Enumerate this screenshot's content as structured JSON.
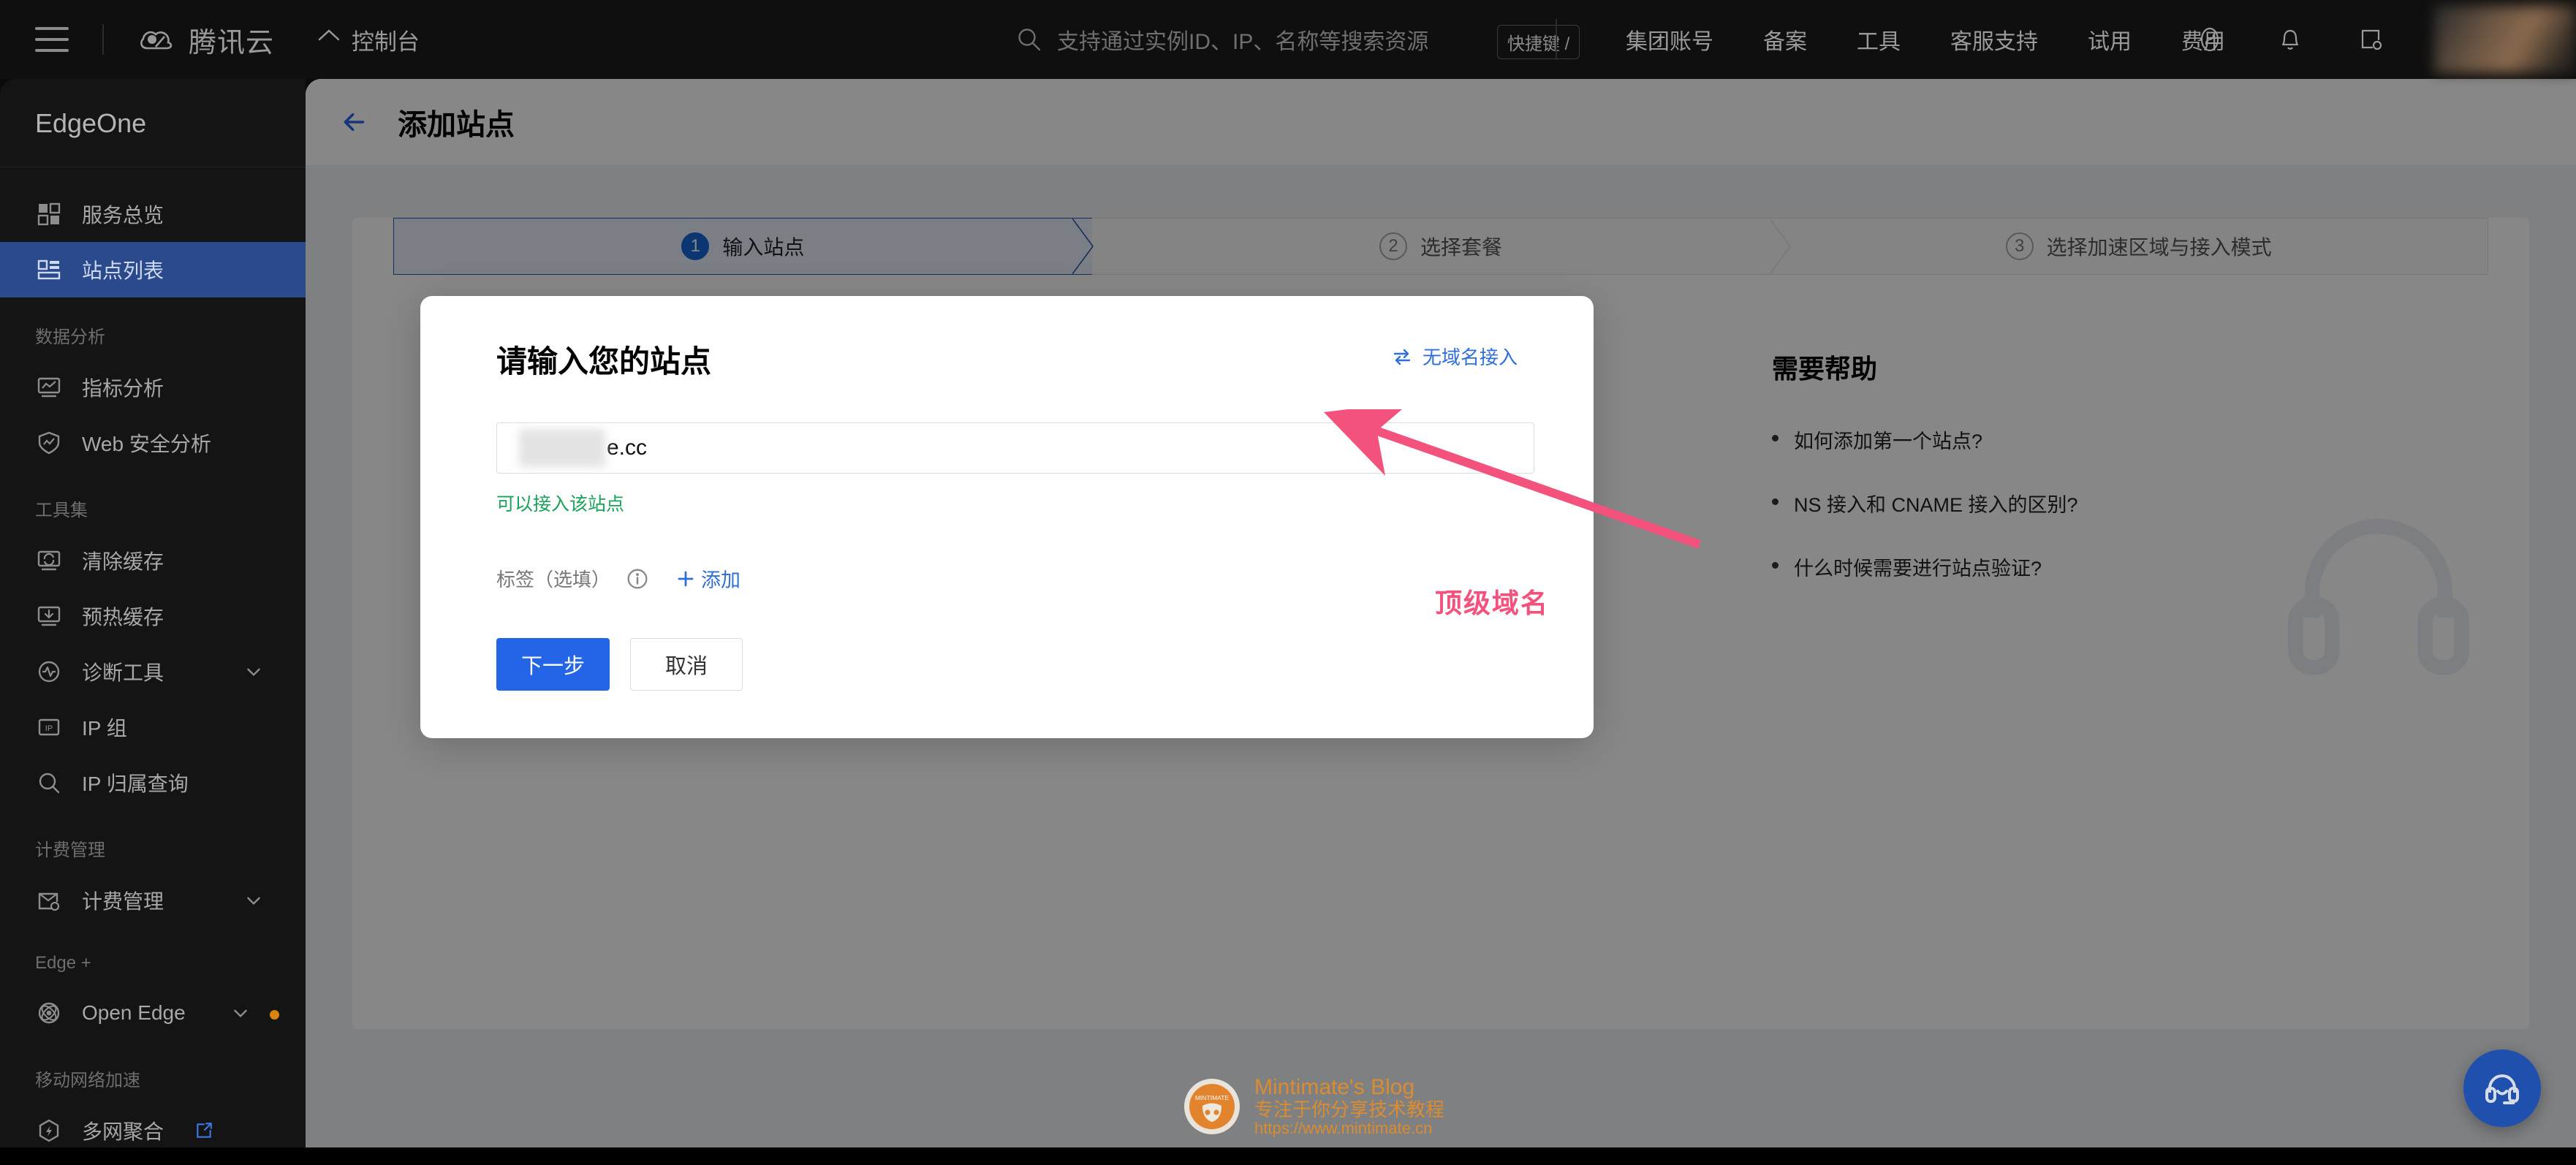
{
  "topbar": {
    "menu_icon": "hamburger-icon",
    "brand": "腾讯云",
    "console": "控制台",
    "search_placeholder": "支持通过实例ID、IP、名称等搜索资源",
    "shortcut_hint": "快捷键 /",
    "nav": [
      {
        "label": "集团账号"
      },
      {
        "label": "备案"
      },
      {
        "label": "工具"
      },
      {
        "label": "客服支持"
      },
      {
        "label": "试用"
      },
      {
        "label": "费用"
      }
    ],
    "icons": [
      "wave-icon",
      "bell-icon",
      "workorder-icon"
    ]
  },
  "sidebar": {
    "title": "EdgeOne",
    "groups": [
      {
        "label": "",
        "items": [
          {
            "label": "服务总览",
            "icon": "grid-icon",
            "active": false
          },
          {
            "label": "站点列表",
            "icon": "sites-icon",
            "active": true
          }
        ]
      },
      {
        "label": "数据分析",
        "items": [
          {
            "label": "指标分析",
            "icon": "chart-monitor-icon",
            "active": false
          },
          {
            "label": "Web 安全分析",
            "icon": "shield-icon",
            "active": false
          }
        ]
      },
      {
        "label": "工具集",
        "items": [
          {
            "label": "清除缓存",
            "icon": "refresh-monitor-icon",
            "active": false
          },
          {
            "label": "预热缓存",
            "icon": "download-monitor-icon",
            "active": false
          },
          {
            "label": "诊断工具",
            "icon": "pulse-icon",
            "active": false,
            "chevron": true
          },
          {
            "label": "IP 组",
            "icon": "ip-box-icon",
            "active": false
          },
          {
            "label": "IP 归属查询",
            "icon": "search-icon",
            "active": false
          }
        ]
      },
      {
        "label": "计费管理",
        "items": [
          {
            "label": "计费管理",
            "icon": "billing-icon",
            "active": false,
            "chevron": true
          }
        ]
      },
      {
        "label": "Edge +",
        "items": [
          {
            "label": "Open Edge",
            "icon": "atom-icon",
            "active": false,
            "chevron": true,
            "dot": true
          }
        ]
      },
      {
        "label": "移动网络加速",
        "items": [
          {
            "label": "多网聚合",
            "icon": "hex-bolt-icon",
            "active": false,
            "external": true
          }
        ]
      }
    ]
  },
  "page": {
    "back_icon": "arrow-left-icon",
    "title": "添加站点"
  },
  "stepper": {
    "steps": [
      {
        "num": "1",
        "label": "输入站点",
        "active": true
      },
      {
        "num": "2",
        "label": "选择套餐",
        "active": false
      },
      {
        "num": "3",
        "label": "选择加速区域与接入模式",
        "active": false
      }
    ]
  },
  "dialog": {
    "title": "请输入您的站点",
    "nodomain_link": "无域名接入",
    "nodomain_icon": "swap-icon",
    "input_value": "e.cc",
    "input_masked": true,
    "valid_message": "可以接入该站点",
    "tag_label": "标签（选填）",
    "tag_info_icon": "info-icon",
    "add_tag_label": "添加",
    "add_tag_icon": "plus-icon",
    "primary_button": "下一步",
    "cancel_button": "取消"
  },
  "help": {
    "title": "需要帮助",
    "items": [
      {
        "label": "如何添加第一个站点?"
      },
      {
        "label": "NS 接入和 CNAME 接入的区别?"
      },
      {
        "label": "什么时候需要进行站点验证?"
      }
    ],
    "background_icon": "headset-watermark-icon"
  },
  "annotation": {
    "text": "顶级域名",
    "color": "#f2527c",
    "arrow_icon": "arrow-pointer-icon"
  },
  "watermark": {
    "title": "Mintimate's Blog",
    "subtitle": "专注于你分享技术教程",
    "url": "https://www.mintimate.cn",
    "logo_text": "MINTIMATE"
  },
  "fab": {
    "icon": "headset-icon",
    "label": "客服支持"
  },
  "colors": {
    "accent": "#2465e8",
    "sidebar_active": "#2a4a8c",
    "success": "#19a35a",
    "annotation": "#f2527c",
    "watermark": "#e08d2c"
  }
}
